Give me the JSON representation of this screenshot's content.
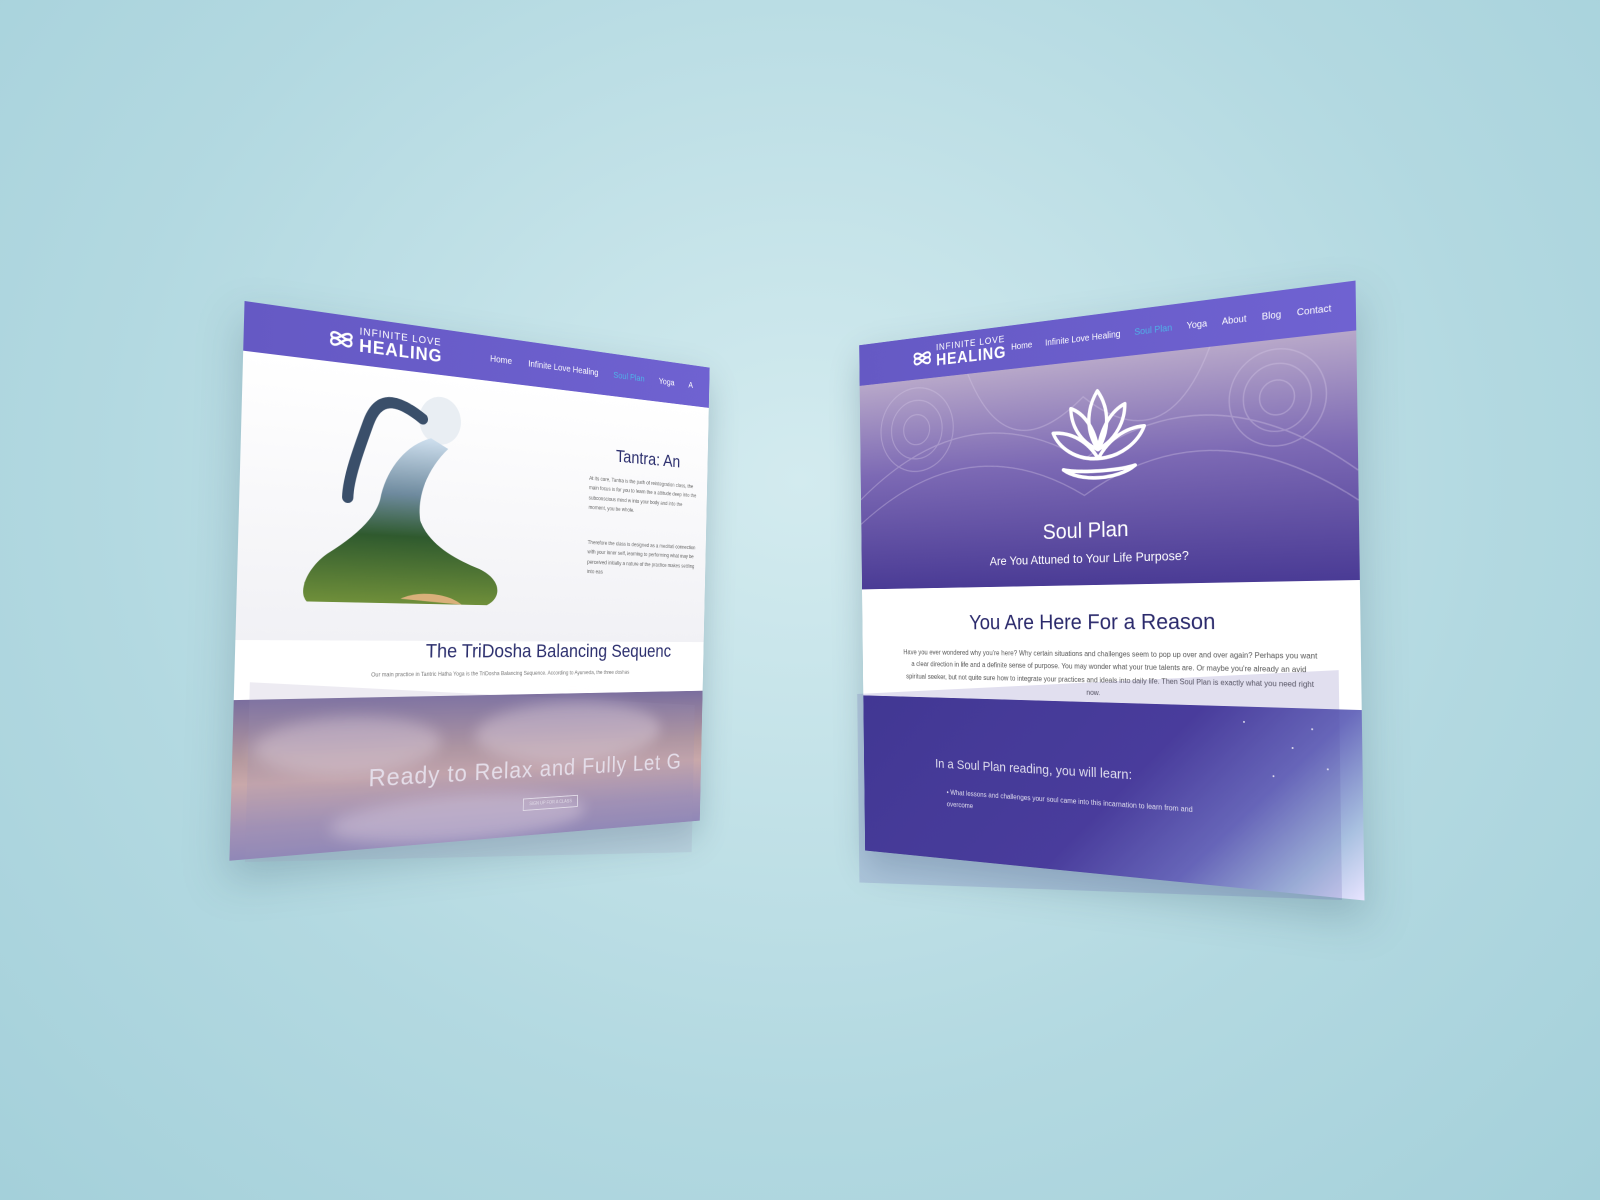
{
  "colors": {
    "background": "#b3d9e1",
    "nav": "#6a5dcb",
    "active_link": "#4fb2e8",
    "heading": "#2c2f6e",
    "hero_bottom": "#4a3b95"
  },
  "left_page": {
    "logo": {
      "line1": "INFINITE LOVE",
      "line2": "HEALING",
      "icon": "infinity-heart-logo-icon"
    },
    "nav": [
      "Home",
      "Infinite Love Healing",
      "Soul Plan",
      "Yoga",
      "A"
    ],
    "active_nav": "Soul Plan",
    "tantra": {
      "title": "Tantra: An",
      "paragraph1": "At its core, Tantra is the path of reintegration class, the main focus is for you to learn the a attitude deep into the subconscious mind w into your body and into the moment, you be whole.",
      "paragraph2": "Therefore the class is designed as a meditati connection with your inner self, learning to performing what may be perceived initially a nature of the practice makes settling into eas"
    },
    "tridosha": {
      "title": "The TriDosha Balancing Sequenc",
      "subtitle": "Our main practice in Tantric Hatha Yoga is the TriDosha Balancing Sequence. According to Ayurveda, the three doshas"
    },
    "cta": {
      "title": "Ready to Relax and Fully Let G",
      "button": "SIGN UP FOR A CLASS"
    }
  },
  "right_page": {
    "logo": {
      "line1": "INFINITE LOVE",
      "line2": "HEALING",
      "icon": "infinity-heart-logo-icon"
    },
    "nav": [
      "Home",
      "Infinite Love Healing",
      "Soul Plan",
      "Yoga",
      "About",
      "Blog",
      "Contact"
    ],
    "active_nav": "Soul Plan",
    "hero": {
      "title": "Soul Plan",
      "subtitle": "Are You Attuned to Your Life Purpose?",
      "icon": "lotus-icon"
    },
    "reason": {
      "title": "You Are Here For a Reason",
      "body": "Have you ever wondered why you're here? Why certain situations and challenges seem to pop up over and over again? Perhaps you want a clear direction in life and a definite sense of purpose. You may wonder what your true talents are. Or maybe you're already an avid spiritual seeker, but not quite sure how to integrate your practices and ideals into daily life. Then Soul Plan is exactly what you need right now."
    },
    "learn": {
      "title": "In a Soul Plan reading, you will learn:",
      "items": [
        "What lessons and challenges your soul came into this incarnation to learn from and overcome"
      ]
    }
  }
}
